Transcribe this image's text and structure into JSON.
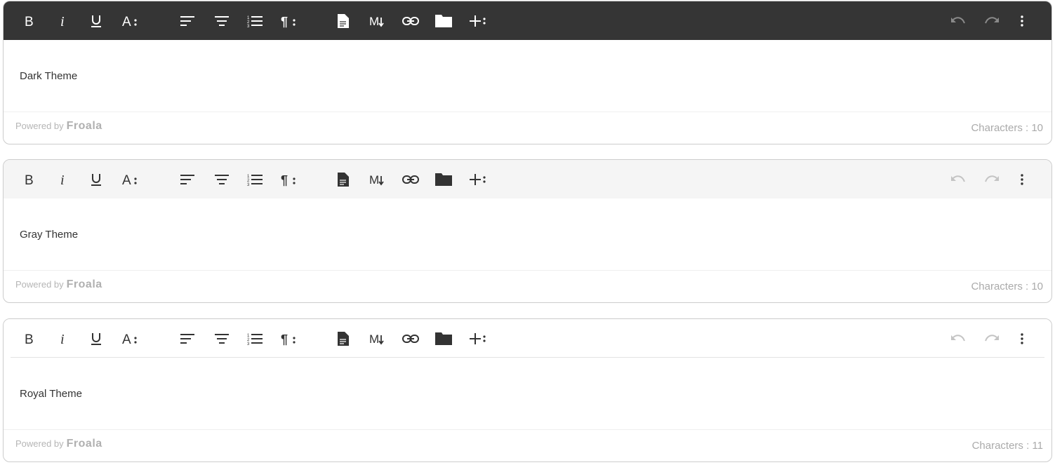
{
  "editors": [
    {
      "theme": "dark",
      "content_text": "Dark Theme",
      "powered_by_label": "Powered by",
      "brand": "Froala",
      "char_count_label": "Characters : 10"
    },
    {
      "theme": "gray",
      "content_text": "Gray Theme",
      "powered_by_label": "Powered by",
      "brand": "Froala",
      "char_count_label": "Characters : 10"
    },
    {
      "theme": "royal",
      "content_text": "Royal Theme",
      "powered_by_label": "Powered by",
      "brand": "Froala",
      "char_count_label": "Characters : 11"
    }
  ],
  "toolbar_buttons": [
    "bold-icon",
    "italic-icon",
    "underline-icon",
    "text-more-icon",
    "align-left-icon",
    "align-center-icon",
    "ordered-list-icon",
    "paragraph-more-icon",
    "insert-file-icon",
    "markdown-icon",
    "link-icon",
    "folder-icon",
    "insert-more-icon",
    "undo-icon",
    "redo-icon",
    "more-vertical-icon"
  ],
  "colors": {
    "dark_toolbar": "#353535",
    "gray_toolbar": "#f5f5f5",
    "royal_toolbar": "#ffffff",
    "text": "#333333"
  }
}
